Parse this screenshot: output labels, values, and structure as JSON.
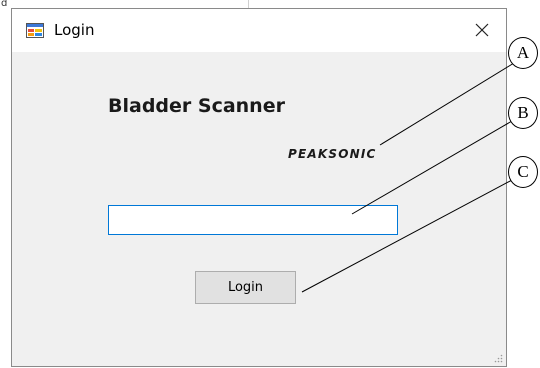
{
  "background": {
    "edge_char": "d"
  },
  "window": {
    "title": "Login",
    "close_glyph": "✕"
  },
  "content": {
    "product_title": "Bladder Scanner",
    "brand": "PEAKSONIC",
    "input_value": "",
    "login_label": "Login"
  },
  "callouts": [
    {
      "label": "A",
      "points_to": "brand-logo"
    },
    {
      "label": "B",
      "points_to": "text-input"
    },
    {
      "label": "C",
      "points_to": "login-button"
    }
  ],
  "colors": {
    "window_bg": "#f0f0f0",
    "input_border": "#0078d7",
    "button_bg": "#e1e1e1"
  }
}
